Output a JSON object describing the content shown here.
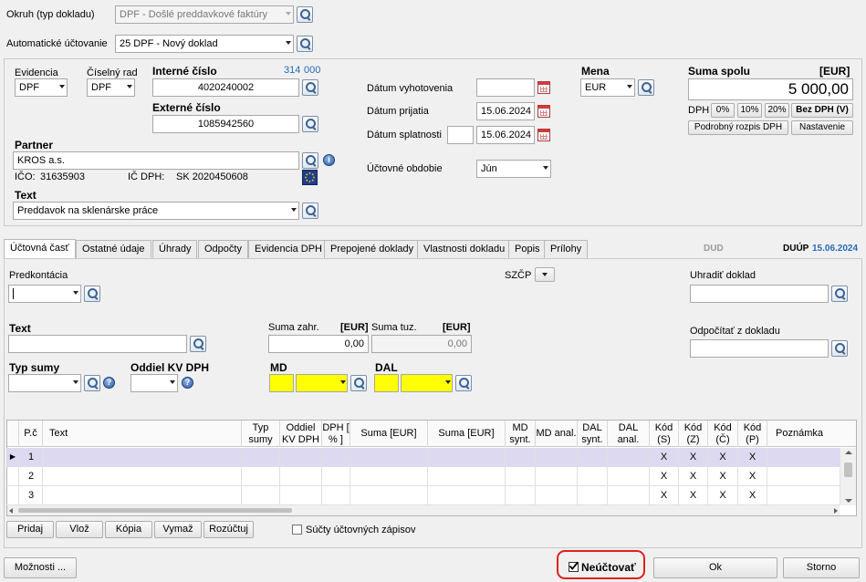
{
  "okruh": {
    "label": "Okruh (typ dokladu)",
    "value": "DPF - Došlé preddavkové faktúry"
  },
  "auto": {
    "label": "Automatické účtovanie",
    "value": "25 DPF - Nový doklad"
  },
  "evidencia": {
    "label": "Evidencia",
    "value": "DPF"
  },
  "ciselny_rad": {
    "label": "Číselný rad",
    "value": "DPF"
  },
  "interne": {
    "label": "Interné číslo",
    "value": "4020240002",
    "counter_a": "314",
    "counter_b": "000"
  },
  "externe": {
    "label": "Externé číslo",
    "value": "1085942560"
  },
  "partner": {
    "label": "Partner",
    "value": "KROS a.s.",
    "ico_label": "IČO:",
    "ico": "31635903",
    "icdph_label": "IČ DPH:",
    "icdph": "SK 2020450608"
  },
  "text": {
    "label": "Text",
    "value": "Preddavok na sklenárske práce"
  },
  "dates": {
    "vyhotovenia": {
      "label": "Dátum vyhotovenia",
      "value": ""
    },
    "prijatia": {
      "label": "Dátum prijatia",
      "value": "15.06.2024"
    },
    "splatnosti": {
      "label": "Dátum splatnosti",
      "value": "15.06.2024"
    }
  },
  "obdobie": {
    "label": "Účtovné obdobie",
    "value": "Jún"
  },
  "mena": {
    "label": "Mena",
    "value": "EUR"
  },
  "suma": {
    "label": "Suma spolu",
    "currency": "[EUR]",
    "value": "5 000,00"
  },
  "dph": {
    "label": "DPH",
    "b0": "0%",
    "b10": "10%",
    "b20": "20%",
    "bez": "Bez DPH (V)",
    "rozpis": "Podrobný rozpis DPH",
    "nastavenie": "Nastavenie"
  },
  "tabs": [
    "Účtovná časť",
    "Ostatné údaje",
    "Úhrady",
    "Odpočty",
    "Evidencia DPH",
    "Prepojené doklady",
    "Vlastnosti dokladu",
    "Popis",
    "Prílohy"
  ],
  "dud": "DUD",
  "duup": {
    "label": "DUÚP",
    "date": "15.06.2024"
  },
  "ucto": {
    "predkontacia": "Predkontácia",
    "szcp": "SZČP",
    "uhradit": "Uhradiť doklad",
    "odpocitat": "Odpočítať z dokladu",
    "text": "Text",
    "suma_zahr": "Suma zahr.",
    "suma_tuz": "Suma tuz.",
    "eur": "[EUR]",
    "suma_zahr_val": "0,00",
    "suma_tuz_val": "0,00",
    "typ_sumy": "Typ sumy",
    "oddiel": "Oddiel KV DPH",
    "md": "MD",
    "dal": "DAL"
  },
  "table": {
    "headers": [
      "P.č",
      "Text",
      "Typ sumy",
      "Oddiel KV DPH",
      "DPH [ % ]",
      "Suma [EUR]",
      "Suma [EUR]",
      "MD synt.",
      "MD anal.",
      "DAL synt.",
      "DAL anal.",
      "Kód (S)",
      "Kód (Z)",
      "Kód (Č)",
      "Kód (P)",
      "Poznámka"
    ],
    "rows": [
      {
        "pc": "1",
        "s": "X",
        "z": "X",
        "c": "X",
        "p": "X"
      },
      {
        "pc": "2",
        "s": "X",
        "z": "X",
        "c": "X",
        "p": "X"
      },
      {
        "pc": "3",
        "s": "X",
        "z": "X",
        "c": "X",
        "p": "X"
      }
    ]
  },
  "actions": {
    "pridaj": "Pridaj",
    "vloz": "Vlož",
    "kopia": "Kópia",
    "vymaz": "Vymaž",
    "rozuctuj": "Rozúčtuj",
    "sucty": "Súčty účtovných zápisov"
  },
  "footer": {
    "moznosti": "Možnosti ...",
    "neuctovat": "Neúčtovať",
    "ok": "Ok",
    "storno": "Storno"
  }
}
